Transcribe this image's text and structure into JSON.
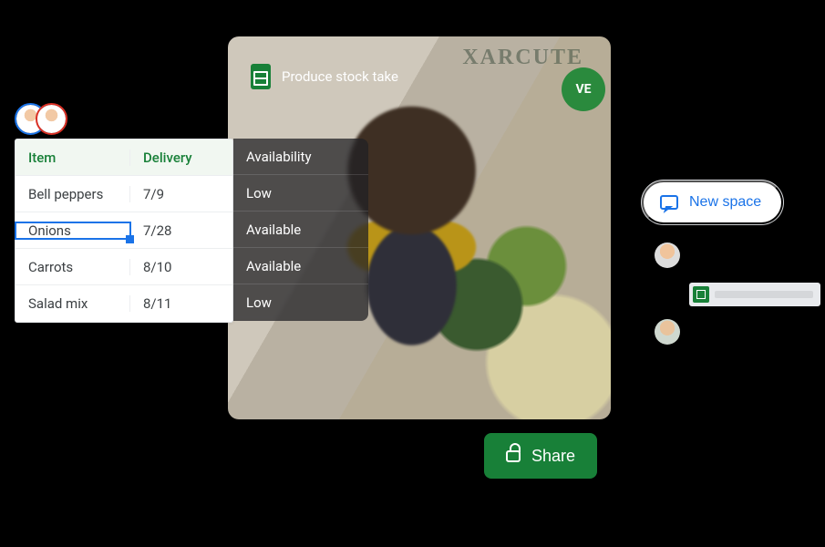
{
  "doc": {
    "title": "Produce stock take"
  },
  "table": {
    "headers": {
      "item": "Item",
      "delivery": "Delivery",
      "availability": "Availability"
    },
    "rows": [
      {
        "item": "Bell peppers",
        "delivery": "7/9",
        "availability": "Low",
        "selected": false
      },
      {
        "item": "Onions",
        "delivery": "7/28",
        "availability": "Available",
        "selected": true
      },
      {
        "item": "Carrots",
        "delivery": "8/10",
        "availability": "Available",
        "selected": false
      },
      {
        "item": "Salad mix",
        "delivery": "8/11",
        "availability": "Low",
        "selected": false
      }
    ]
  },
  "new_space": {
    "label": "New space"
  },
  "share": {
    "label": "Share"
  },
  "photo_sign": "XARCUTE",
  "photo_badge": "VE"
}
